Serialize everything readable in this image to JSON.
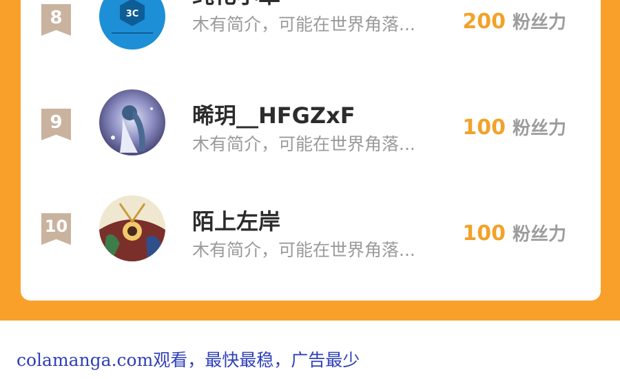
{
  "ranking": {
    "rows": [
      {
        "rank": "8",
        "name": "纯化小單",
        "intro": "木有简介，可能在世界角落...",
        "fans_value": "200",
        "fans_unit": "粉丝力",
        "avatar_icon": "3c-logo-avatar",
        "avatar_logo_text": "3C"
      },
      {
        "rank": "9",
        "name": "晞玥__HFGZxF",
        "intro": "木有简介，可能在世界角落...",
        "fans_value": "100",
        "fans_unit": "粉丝力",
        "avatar_icon": "anime-girl-avatar"
      },
      {
        "rank": "10",
        "name": "陌上左岸",
        "intro": "木有简介，可能在世界角落...",
        "fans_value": "100",
        "fans_unit": "粉丝力",
        "avatar_icon": "anime-group-avatar"
      }
    ]
  },
  "footer": {
    "text": "colamanga.com观看，最快最稳，广告最少"
  },
  "colors": {
    "accent_orange": "#f9a02a",
    "fans_value": "#f2a22a",
    "rank_badge": "#c9b39f",
    "footer_link": "#2e3fb8"
  }
}
